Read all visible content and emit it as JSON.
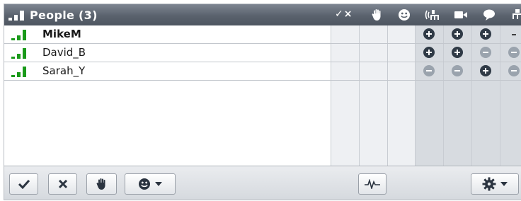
{
  "header": {
    "title": "People (3)",
    "check_x_label": "✓×",
    "column_icons": [
      "raise-hand-icon",
      "smiley-icon",
      "audio-icon",
      "video-icon",
      "chat-icon",
      "share-icon"
    ]
  },
  "participants": [
    {
      "name": "MikeM",
      "bold": true,
      "permissions": [
        "plus",
        "plus",
        "plus",
        "dash"
      ]
    },
    {
      "name": "David_B",
      "bold": false,
      "permissions": [
        "plus",
        "plus",
        "minus",
        "minus"
      ]
    },
    {
      "name": "Sarah_Y",
      "bold": false,
      "permissions": [
        "minus",
        "minus",
        "plus",
        "minus"
      ]
    }
  ],
  "toolbar": {
    "buttons": [
      "check-icon",
      "close-icon",
      "raise-hand-icon",
      "smiley-dropdown",
      "activity-icon",
      "gear-dropdown"
    ]
  },
  "colors": {
    "header_bg": "#5a626d",
    "signal_green": "#1a9a1a",
    "plus_dark": "#2f3a46",
    "minus_grey": "#9aa3ad",
    "perm_column_bg": "#d7dbe0",
    "status_column_bg": "#eef0f3"
  }
}
